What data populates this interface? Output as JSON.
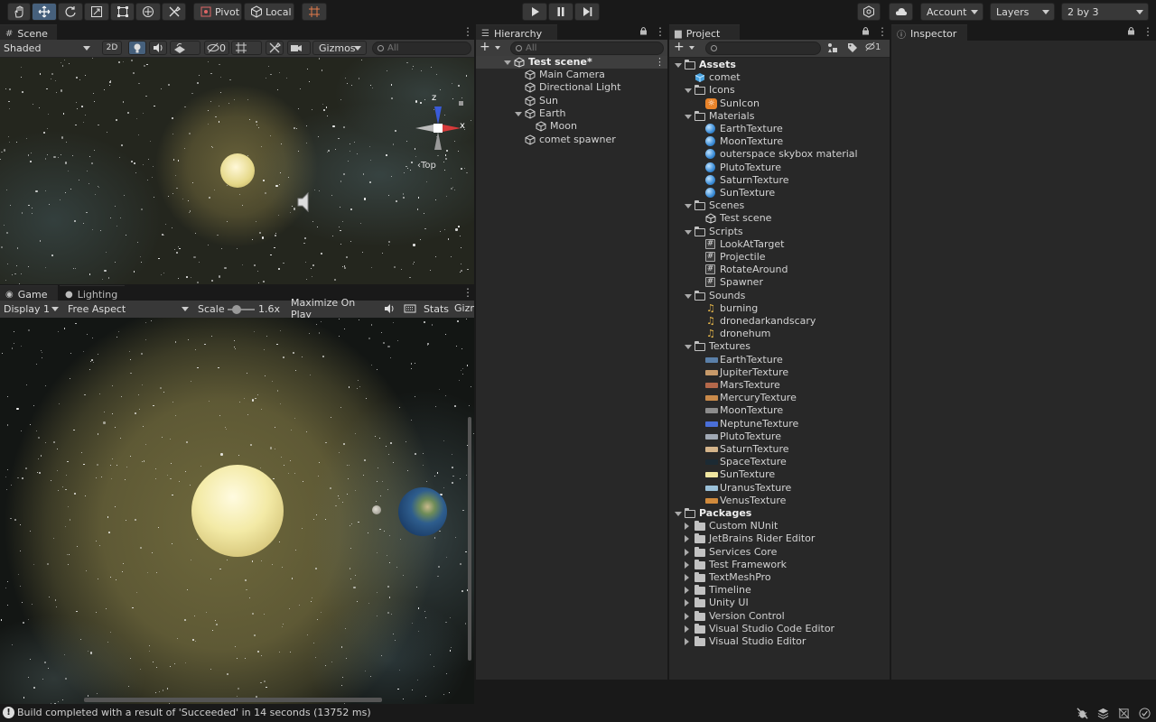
{
  "toolbar": {
    "pivot_label": "Pivot",
    "local_label": "Local",
    "account_label": "Account",
    "layers_label": "Layers",
    "layout_label": "2 by 3"
  },
  "scene": {
    "tab_label": "Scene",
    "shading_mode": "Shaded",
    "mode_2d": "2D",
    "hidden_count": "0",
    "gizmos_label": "Gizmos",
    "search_placeholder": "All",
    "gizmo_z": "z",
    "gizmo_x": "x",
    "gizmo_view": "Top"
  },
  "game": {
    "tab_label": "Game",
    "lighting_tab_label": "Lighting",
    "display_label": "Display 1",
    "aspect_label": "Free Aspect",
    "scale_label": "Scale",
    "scale_value": "1.6x",
    "maximize_label": "Maximize On Play",
    "stats_label": "Stats",
    "gizmos_label": "Gizm"
  },
  "hierarchy": {
    "tab_label": "Hierarchy",
    "search_placeholder": "All",
    "scene_name": "Test scene*",
    "items": [
      {
        "label": "Main Camera",
        "depth": 1
      },
      {
        "label": "Directional Light",
        "depth": 1
      },
      {
        "label": "Sun",
        "depth": 1
      },
      {
        "label": "Earth",
        "depth": 1,
        "expanded": true
      },
      {
        "label": "Moon",
        "depth": 2
      },
      {
        "label": "comet spawner",
        "depth": 1
      }
    ]
  },
  "project": {
    "tab_label": "Project",
    "search_placeholder": "",
    "hidden_count": "1",
    "assets_label": "Assets",
    "packages_label": "Packages",
    "rows": [
      {
        "label": "comet",
        "depth": 1,
        "kind": "prefab"
      },
      {
        "label": "Icons",
        "depth": 1,
        "kind": "folder-open"
      },
      {
        "label": "SunIcon",
        "depth": 2,
        "kind": "sunicon"
      },
      {
        "label": "Materials",
        "depth": 1,
        "kind": "folder-open"
      },
      {
        "label": "EarthTexture",
        "depth": 2,
        "kind": "material"
      },
      {
        "label": "MoonTexture",
        "depth": 2,
        "kind": "material"
      },
      {
        "label": "outerspace skybox material",
        "depth": 2,
        "kind": "material"
      },
      {
        "label": "PlutoTexture",
        "depth": 2,
        "kind": "material"
      },
      {
        "label": "SaturnTexture",
        "depth": 2,
        "kind": "material"
      },
      {
        "label": "SunTexture",
        "depth": 2,
        "kind": "material"
      },
      {
        "label": "Scenes",
        "depth": 1,
        "kind": "folder-open"
      },
      {
        "label": "Test scene",
        "depth": 2,
        "kind": "scene"
      },
      {
        "label": "Scripts",
        "depth": 1,
        "kind": "folder-open"
      },
      {
        "label": "LookAtTarget",
        "depth": 2,
        "kind": "script"
      },
      {
        "label": "Projectile",
        "depth": 2,
        "kind": "script"
      },
      {
        "label": "RotateAround",
        "depth": 2,
        "kind": "script"
      },
      {
        "label": "Spawner",
        "depth": 2,
        "kind": "script"
      },
      {
        "label": "Sounds",
        "depth": 1,
        "kind": "folder-open"
      },
      {
        "label": "burning",
        "depth": 2,
        "kind": "audio"
      },
      {
        "label": "dronedarkandscary",
        "depth": 2,
        "kind": "audio"
      },
      {
        "label": "dronehum",
        "depth": 2,
        "kind": "audio"
      },
      {
        "label": "Textures",
        "depth": 1,
        "kind": "folder-open"
      },
      {
        "label": "EarthTexture",
        "depth": 2,
        "kind": "texture",
        "color": "#5a7fa8"
      },
      {
        "label": "JupiterTexture",
        "depth": 2,
        "kind": "texture",
        "color": "#c79a6a"
      },
      {
        "label": "MarsTexture",
        "depth": 2,
        "kind": "texture",
        "color": "#b4684a"
      },
      {
        "label": "MercuryTexture",
        "depth": 2,
        "kind": "texture",
        "color": "#c98a4a"
      },
      {
        "label": "MoonTexture",
        "depth": 2,
        "kind": "texture",
        "color": "#8c8c8c"
      },
      {
        "label": "NeptuneTexture",
        "depth": 2,
        "kind": "texture",
        "color": "#4a6fd8"
      },
      {
        "label": "PlutoTexture",
        "depth": 2,
        "kind": "texture",
        "color": "#a0a8b4"
      },
      {
        "label": "SaturnTexture",
        "depth": 2,
        "kind": "texture",
        "color": "#d4b48a"
      },
      {
        "label": "SpaceTexture",
        "depth": 2,
        "kind": "texture",
        "color": "#1c2a33"
      },
      {
        "label": "SunTexture",
        "depth": 2,
        "kind": "texture",
        "color": "#f0e6a0"
      },
      {
        "label": "UranusTexture",
        "depth": 2,
        "kind": "texture",
        "color": "#9ac0d8"
      },
      {
        "label": "VenusTexture",
        "depth": 2,
        "kind": "texture",
        "color": "#d08a3c"
      }
    ],
    "packages": [
      "Custom NUnit",
      "JetBrains Rider Editor",
      "Services Core",
      "Test Framework",
      "TextMeshPro",
      "Timeline",
      "Unity UI",
      "Version Control",
      "Visual Studio Code Editor",
      "Visual Studio Editor"
    ]
  },
  "inspector": {
    "tab_label": "Inspector"
  },
  "status": {
    "message": "Build completed with a result of 'Succeeded' in 14 seconds (13752 ms)"
  }
}
